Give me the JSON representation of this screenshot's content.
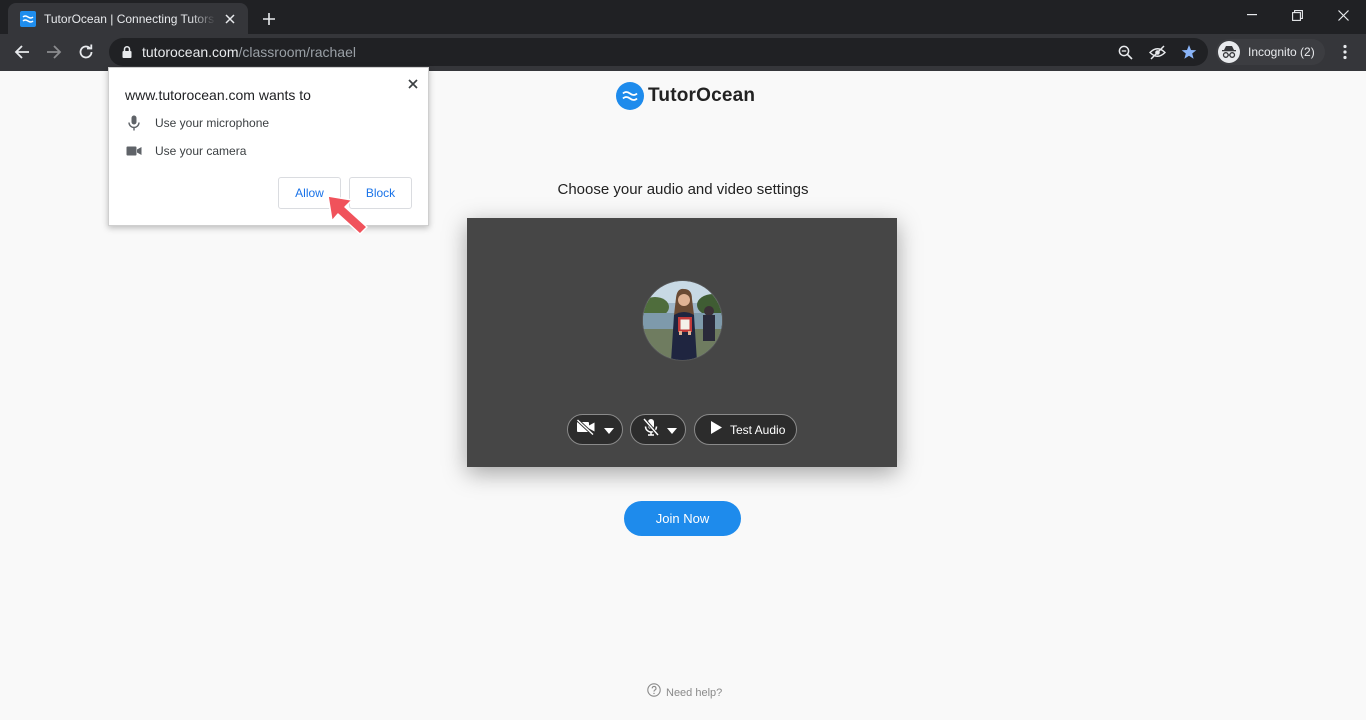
{
  "browser": {
    "tab": {
      "title": "TutorOcean | Connecting Tutors and Students"
    },
    "url": {
      "host": "tutorocean.com",
      "path": "/classroom/rachael"
    },
    "incognito_label": "Incognito (2)"
  },
  "page": {
    "logo_text": "TutorOcean",
    "settings_title": "Choose your audio and video settings",
    "test_audio_label": "Test Audio",
    "join_label": "Join Now",
    "help_label": "Need help?"
  },
  "permission": {
    "title": "www.tutorocean.com wants to",
    "items": [
      {
        "label": "Use your microphone",
        "icon": "microphone-icon"
      },
      {
        "label": "Use your camera",
        "icon": "camera-icon"
      }
    ],
    "allow_label": "Allow",
    "block_label": "Block"
  },
  "colors": {
    "brand": "#1e8bec",
    "chrome_dark": "#202124",
    "chrome_toolbar": "#35363a",
    "preview_bg": "#464646",
    "pointer_arrow": "#f0525b"
  }
}
